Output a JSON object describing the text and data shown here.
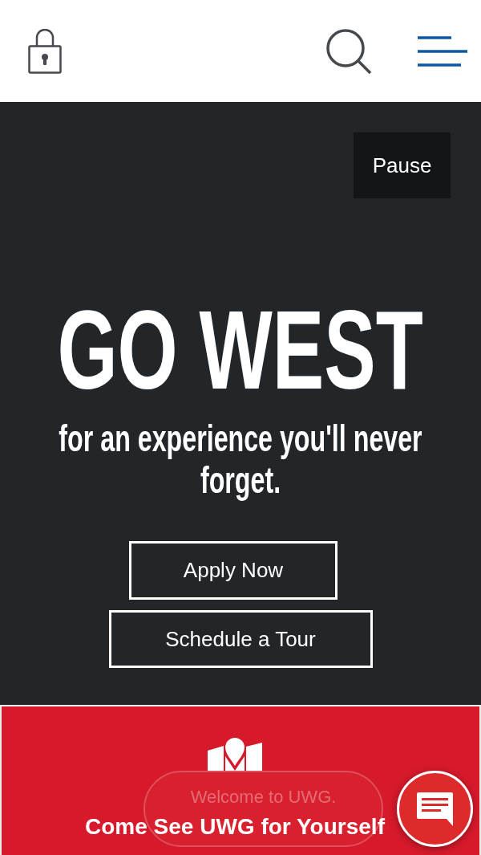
{
  "hero": {
    "pause_button": "Pause",
    "title": "GO WEST",
    "subtitle": "for an experience you'll never forget.",
    "buttons": [
      "Apply Now",
      "Schedule a Tour"
    ]
  },
  "promo": {
    "heading": "Come See UWG for Yourself"
  },
  "chat": {
    "greeting": "Welcome to UWG."
  }
}
